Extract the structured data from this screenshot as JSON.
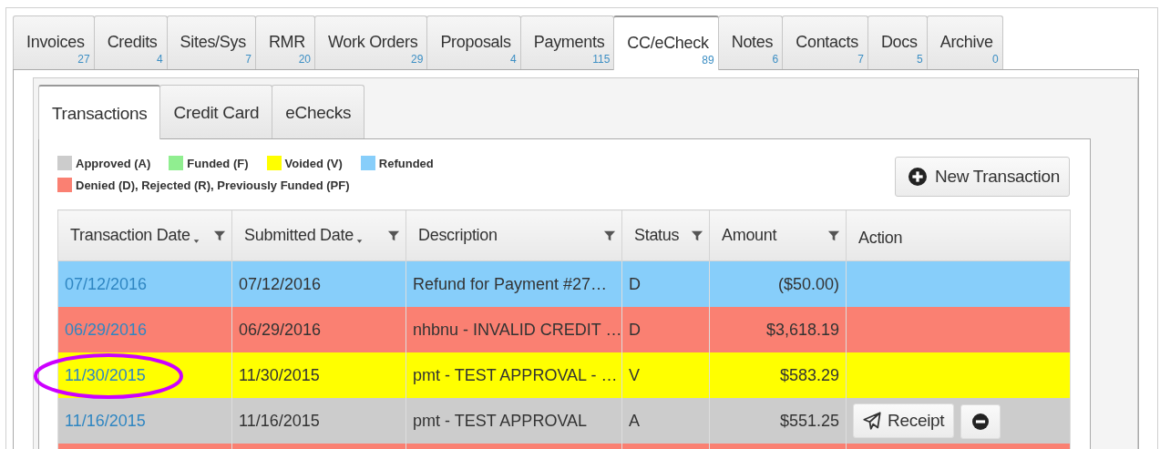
{
  "tabs": [
    {
      "label": "Invoices",
      "count": "27",
      "selected": false
    },
    {
      "label": "Credits",
      "count": "4",
      "selected": false
    },
    {
      "label": "Sites/Sys",
      "count": "7",
      "selected": false
    },
    {
      "label": "RMR",
      "count": "20",
      "selected": false
    },
    {
      "label": "Work Orders",
      "count": "29",
      "selected": false
    },
    {
      "label": "Proposals",
      "count": "4",
      "selected": false
    },
    {
      "label": "Payments",
      "count": "115",
      "selected": false
    },
    {
      "label": "CC/eCheck",
      "count": "89",
      "selected": true
    },
    {
      "label": "Notes",
      "count": "6",
      "selected": false
    },
    {
      "label": "Contacts",
      "count": "7",
      "selected": false
    },
    {
      "label": "Docs",
      "count": "5",
      "selected": false
    },
    {
      "label": "Archive",
      "count": "0",
      "selected": false
    }
  ],
  "subtabs": [
    {
      "label": "Transactions",
      "selected": true
    },
    {
      "label": "Credit Card",
      "selected": false
    },
    {
      "label": "eChecks",
      "selected": false
    }
  ],
  "legend": [
    {
      "label": "Approved (A)",
      "color": "#cccccc"
    },
    {
      "label": "Funded (F)",
      "color": "#90ee90"
    },
    {
      "label": "Voided (V)",
      "color": "#ffff00"
    },
    {
      "label": "Refunded",
      "color": "#87cefa"
    },
    {
      "label": "Denied (D), Rejected (R), Previously Funded (PF)",
      "color": "#fa8072"
    }
  ],
  "new_button": {
    "label": "New Transaction"
  },
  "table": {
    "columns": [
      {
        "label": "Transaction Date",
        "sorted": true,
        "filter": true
      },
      {
        "label": "Submitted Date",
        "sorted": true,
        "filter": true
      },
      {
        "label": "Description",
        "sorted": false,
        "filter": true
      },
      {
        "label": "Status",
        "sorted": false,
        "filter": true
      },
      {
        "label": "Amount",
        "sorted": false,
        "filter": true
      },
      {
        "label": "Action",
        "sorted": false,
        "filter": false
      }
    ],
    "rows": [
      {
        "transaction_date": "07/12/2016",
        "submitted_date": "07/12/2016",
        "description": "Refund for Payment #27…",
        "status": "D",
        "amount": "($50.00)",
        "color": "#87cefa",
        "actions": []
      },
      {
        "transaction_date": "06/29/2016",
        "submitted_date": "06/29/2016",
        "description": "nhbnu - INVALID CREDIT …",
        "status": "D",
        "amount": "$3,618.19",
        "color": "#fa8072",
        "actions": []
      },
      {
        "transaction_date": "11/30/2015",
        "submitted_date": "11/30/2015",
        "description": "pmt - TEST APPROVAL - …",
        "status": "V",
        "amount": "$583.29",
        "color": "#ffff00",
        "circled": true,
        "actions": []
      },
      {
        "transaction_date": "11/16/2015",
        "submitted_date": "11/16/2015",
        "description": "pmt - TEST APPROVAL",
        "status": "A",
        "amount": "$551.25",
        "color": "#cccccc",
        "actions": [
          {
            "kind": "receipt",
            "label": "Receipt"
          },
          {
            "kind": "remove"
          }
        ]
      },
      {
        "color": "#fa8072",
        "actions": []
      }
    ]
  }
}
